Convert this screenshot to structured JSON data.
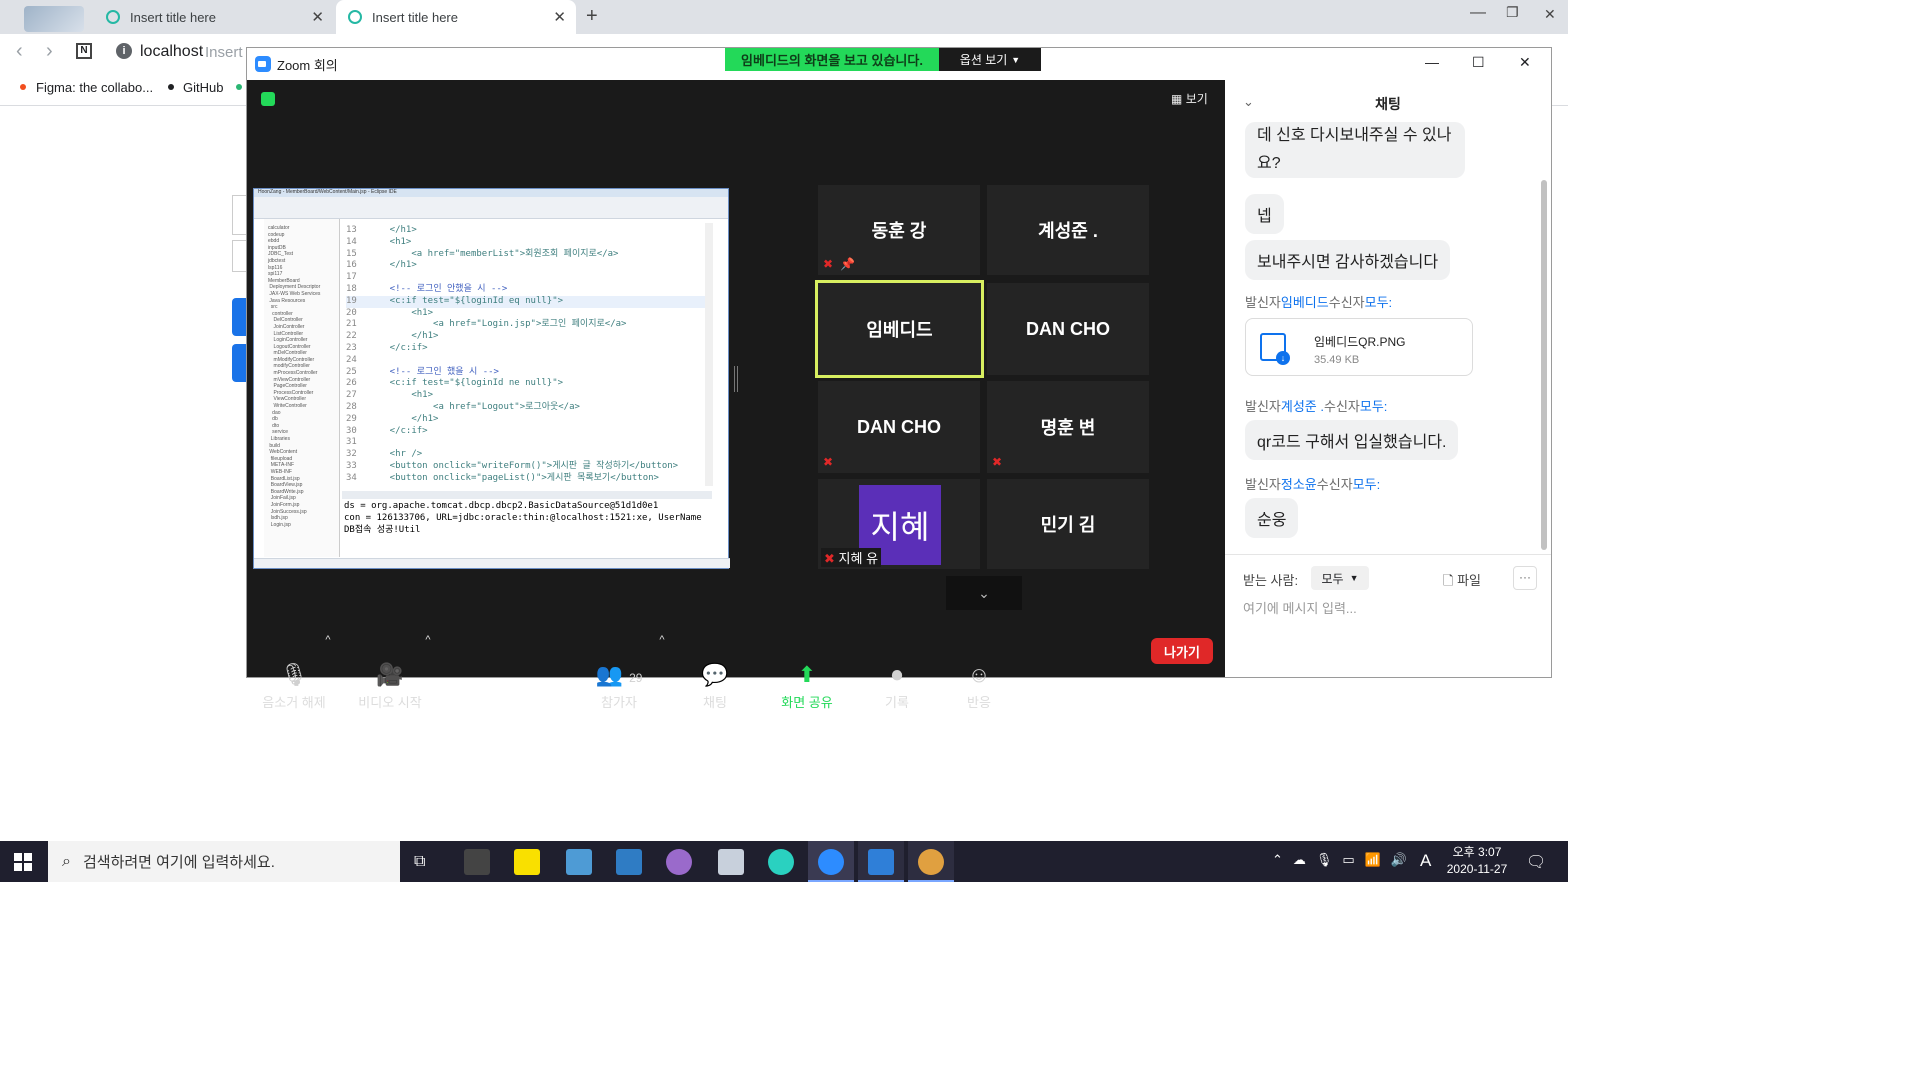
{
  "browser": {
    "tabs": [
      {
        "title": "Insert title here"
      },
      {
        "title": "Insert title here"
      }
    ],
    "address": "localhost",
    "address_hint": "Insert",
    "bookmarks": [
      {
        "label": "Figma: the collabo..."
      },
      {
        "label": "GitHub"
      }
    ]
  },
  "zoom": {
    "window_title": "Zoom 회의",
    "banner": "임베디드의 화면을 보고 있습니다.",
    "options_label": "옵션 보기",
    "view_label": "보기",
    "participants": [
      {
        "name": "동훈 강",
        "muted": true,
        "pinned": true
      },
      {
        "name": "계성준 .",
        "muted": false
      },
      {
        "name": "임베디드",
        "active": true
      },
      {
        "name": "DAN CHO"
      },
      {
        "name": "DAN CHO",
        "muted": true
      },
      {
        "name": "명훈 변",
        "muted": true
      },
      {
        "name": "지혜 유",
        "avatar": "지혜",
        "muted": true
      },
      {
        "name": "민기 김"
      }
    ],
    "toolbar": {
      "unmute": "음소거 해제",
      "start_video": "비디오 시작",
      "participants_label": "참가자",
      "participants_count": "29",
      "chat": "채팅",
      "share": "화면 공유",
      "record": "기록",
      "reactions": "반응",
      "leave": "나가기"
    },
    "chat": {
      "title": "채팅",
      "messages": [
        {
          "text": "데 신호 다시보내주실 수 있나\n요?"
        },
        {
          "text": "넵"
        },
        {
          "text": "보내주시면 감사하겠습니다"
        }
      ],
      "file_sender": {
        "prefix": "발신자",
        "from": "임베디드",
        "mid": "수신자",
        "to": "모두:"
      },
      "file": {
        "name": "임베디드QR.PNG",
        "size": "35.49 KB"
      },
      "sender2": {
        "prefix": "발신자",
        "from": "계성준 .",
        "mid": "수신자",
        "to": "모두:"
      },
      "msg2": "qr코드 구해서 입실했습니다.",
      "sender3": {
        "prefix": "발신자",
        "from": "정소윤",
        "mid": "수신자",
        "to": "모두:"
      },
      "msg3": "순웅",
      "to_label": "받는 사람:",
      "to_value": "모두",
      "file_label": "파일",
      "placeholder": "여기에 메시지 입력..."
    }
  },
  "eclipse": {
    "title": "HoonZang - MemberBoard/WebContent/Main.jsp - Eclipse IDE",
    "code_lines": [
      {
        "n": "13",
        "t": "    </h1>"
      },
      {
        "n": "14",
        "t": "    <h1>"
      },
      {
        "n": "15",
        "t": "        <a href=\"memberList\">회원조회 페이지로</a>"
      },
      {
        "n": "16",
        "t": "    </h1>"
      },
      {
        "n": "17",
        "t": ""
      },
      {
        "n": "18",
        "t": "    <!-- 로그인 안했을 시 -->"
      },
      {
        "n": "19",
        "t": "    <c:if test=\"${loginId eq null}\">"
      },
      {
        "n": "20",
        "t": "        <h1>"
      },
      {
        "n": "21",
        "t": "            <a href=\"Login.jsp\">로그인 페이지로</a>"
      },
      {
        "n": "22",
        "t": "        </h1>"
      },
      {
        "n": "23",
        "t": "    </c:if>"
      },
      {
        "n": "24",
        "t": ""
      },
      {
        "n": "25",
        "t": "    <!-- 로그인 했을 시 -->"
      },
      {
        "n": "26",
        "t": "    <c:if test=\"${loginId ne null}\">"
      },
      {
        "n": "27",
        "t": "        <h1>"
      },
      {
        "n": "28",
        "t": "            <a href=\"Logout\">로그아웃</a>"
      },
      {
        "n": "29",
        "t": "        </h1>"
      },
      {
        "n": "30",
        "t": "    </c:if>"
      },
      {
        "n": "31",
        "t": ""
      },
      {
        "n": "32",
        "t": "    <hr />"
      },
      {
        "n": "33",
        "t": "    <button onclick=\"writeForm()\">게시판 글 작성하기</button>"
      },
      {
        "n": "34",
        "t": "    <button onclick=\"pageList()\">게시판 목록보기</button>"
      }
    ],
    "console": [
      "ds = org.apache.tomcat.dbcp.dbcp2.BasicDataSource@51d1d0e1",
      "con = 126133706, URL=jdbc:oracle:thin:@localhost:1521:xe, UserName",
      "DB접속 성공!Util"
    ]
  },
  "taskbar": {
    "search_placeholder": "검색하려면 여기에 입력하세요.",
    "time": "오후 3:07",
    "date": "2020-11-27",
    "ime": "A"
  }
}
